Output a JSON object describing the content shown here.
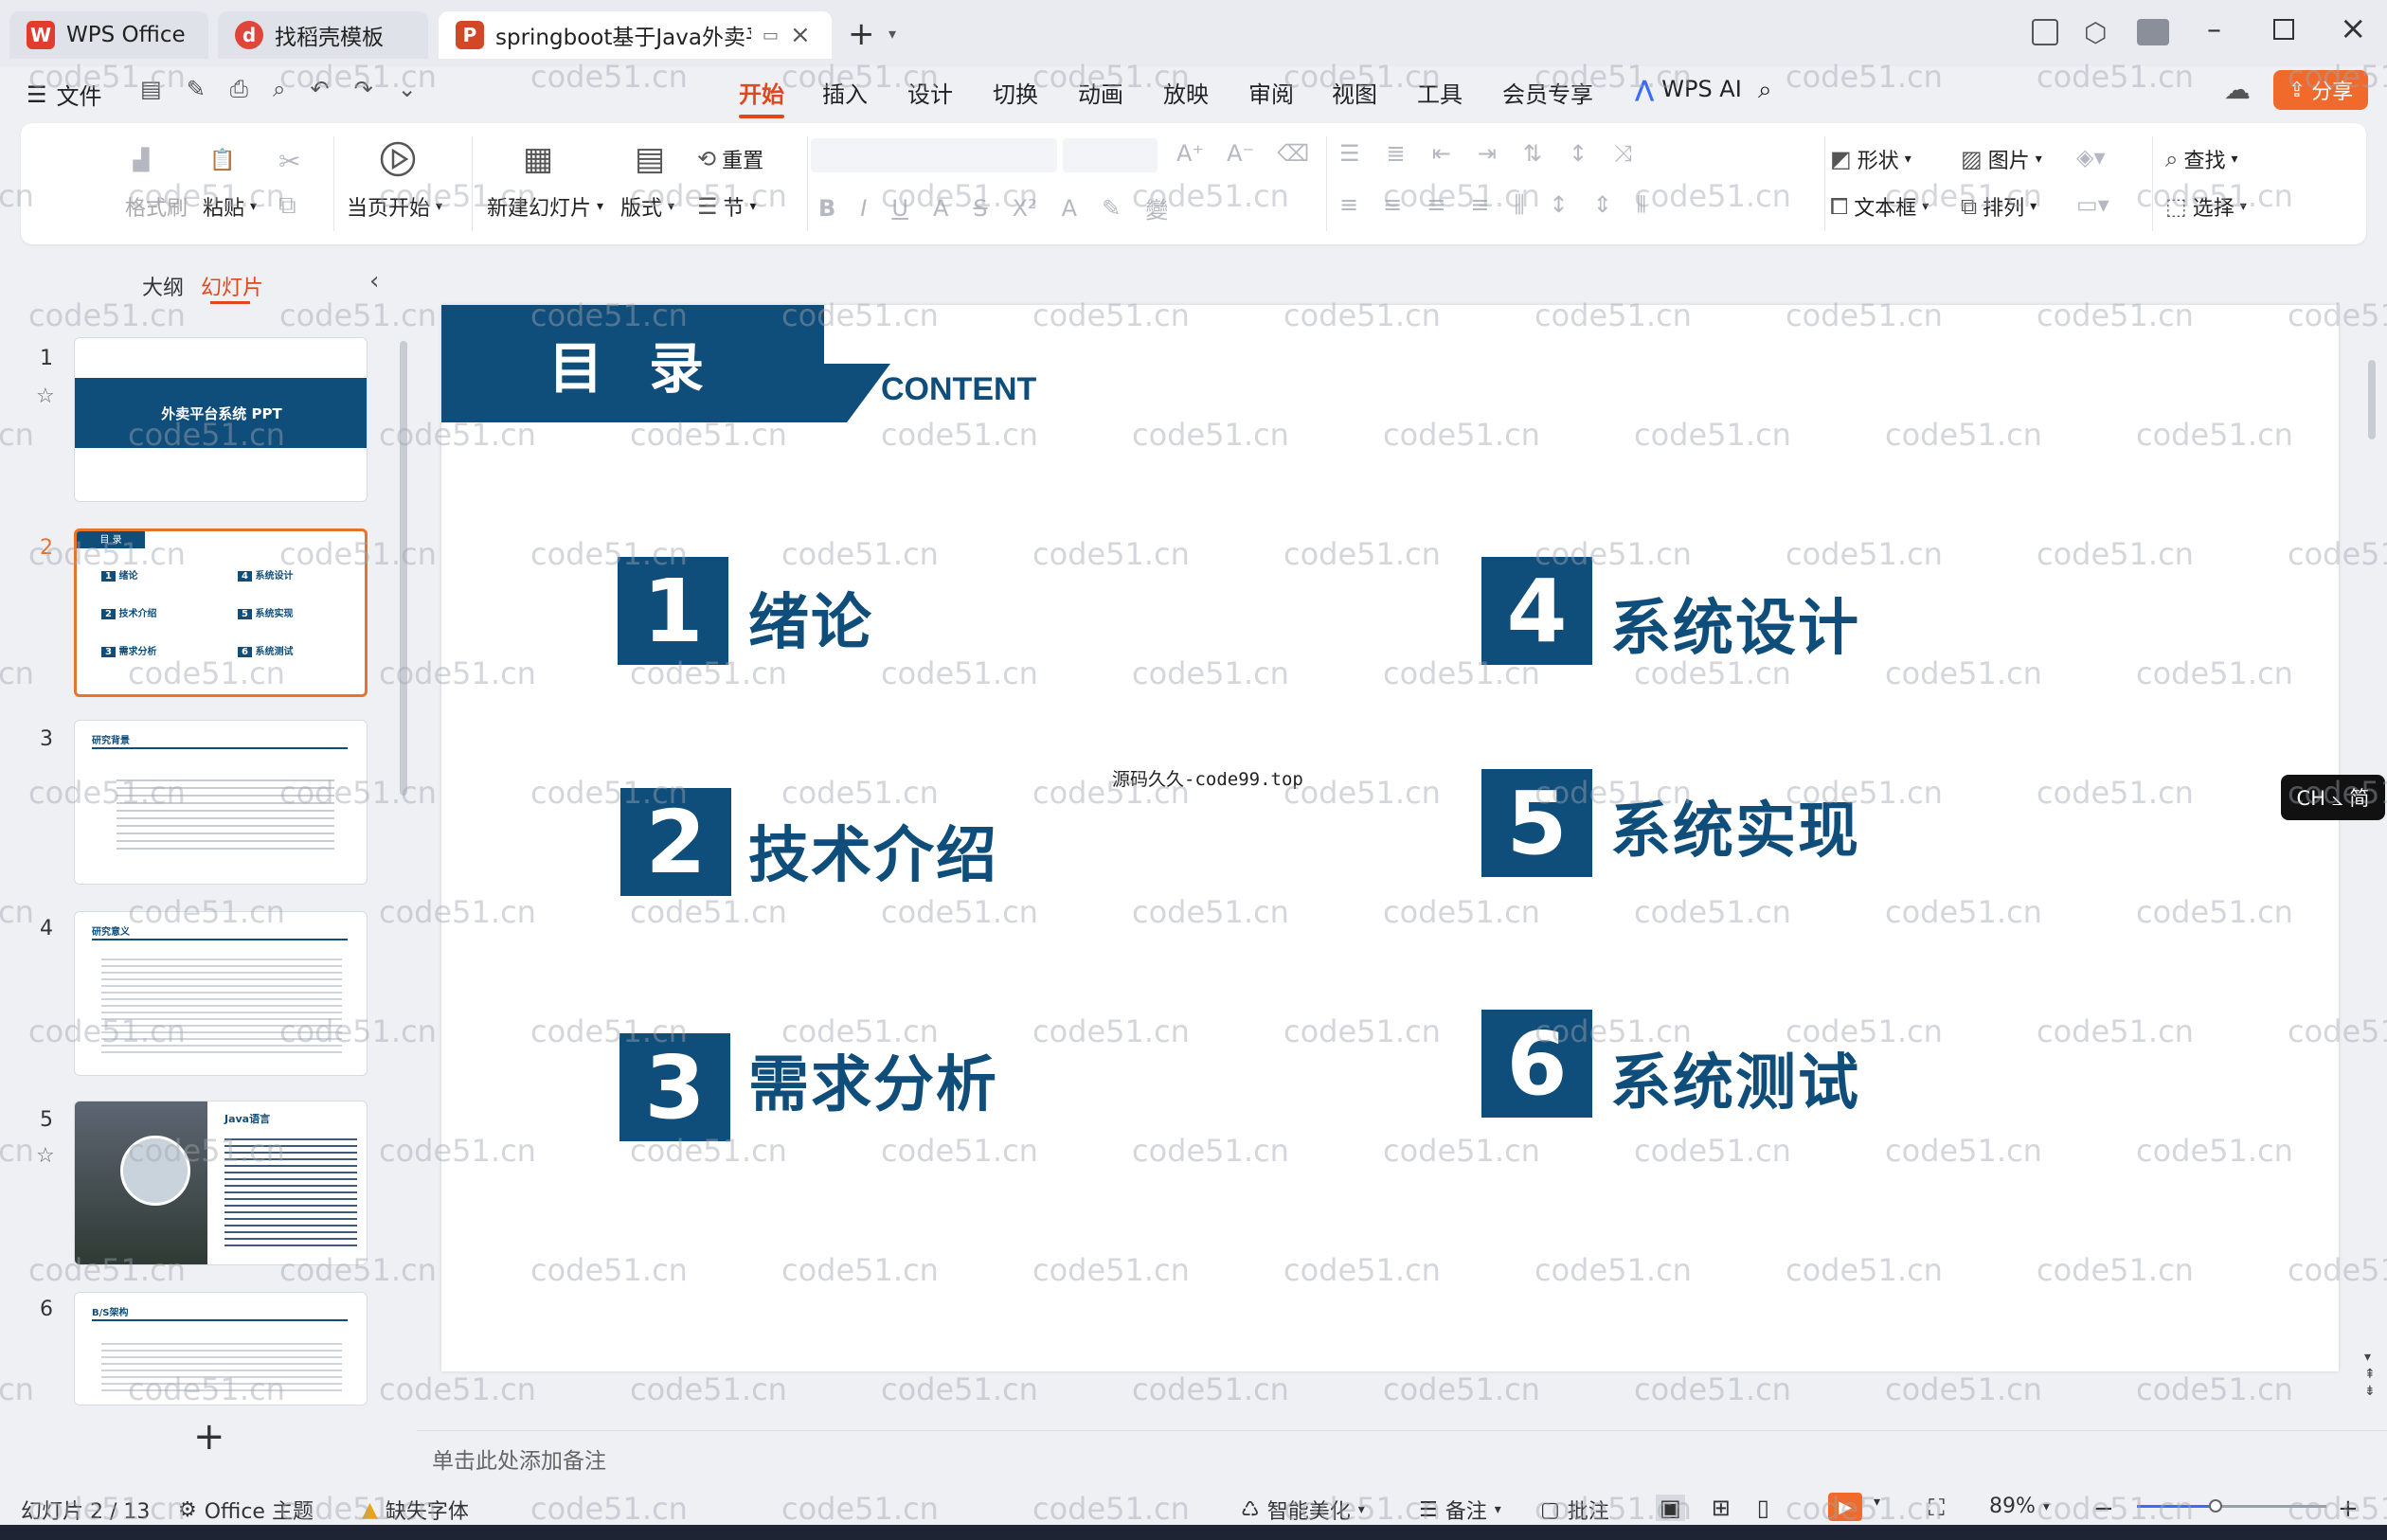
{
  "titlebar": {
    "tabs": [
      {
        "label": "WPS Office"
      },
      {
        "label": "找稻壳模板"
      },
      {
        "label": "springboot基于Java外卖平台"
      }
    ],
    "new_tab": "+",
    "window_controls": [
      "minimize",
      "maximize",
      "close"
    ]
  },
  "menu": {
    "file": "文件",
    "tabs": [
      "开始",
      "插入",
      "设计",
      "切换",
      "动画",
      "放映",
      "审阅",
      "视图",
      "工具",
      "会员专享"
    ],
    "active_tab": "开始",
    "wps_ai": "WPS AI",
    "share": "分享"
  },
  "ribbon": {
    "format_painter": "格式刷",
    "paste": "粘贴",
    "from_current": "当页开始",
    "new_slide": "新建幻灯片",
    "layout": "版式",
    "section": "节",
    "reset": "重置",
    "shape": "形状",
    "picture": "图片",
    "find": "查找",
    "textbox": "文本框",
    "arrange": "排列",
    "select": "选择"
  },
  "left_panel": {
    "tab_outline": "大纲",
    "tab_slides": "幻灯片",
    "active": "幻灯片",
    "thumb1_title": "外卖平台系统 PPT",
    "thumb2_title": "目 录",
    "thumb2_items": [
      "绪论",
      "技术介绍",
      "需求分析",
      "系统设计",
      "系统实现",
      "系统测试"
    ],
    "thumb3_title": "研究背景",
    "thumb4_title": "研究意义",
    "thumb5_title": "Java语言",
    "thumb6_title": "B/S架构",
    "slide_numbers": [
      "1",
      "2",
      "3",
      "4",
      "5",
      "6"
    ],
    "add": "+"
  },
  "slide": {
    "title": "目 录",
    "subtitle": "CONTENT",
    "items": [
      {
        "num": "1",
        "label": "绪论"
      },
      {
        "num": "2",
        "label": "技术介绍"
      },
      {
        "num": "3",
        "label": "需求分析"
      },
      {
        "num": "4",
        "label": "系统设计"
      },
      {
        "num": "5",
        "label": "系统实现"
      },
      {
        "num": "6",
        "label": "系统测试"
      }
    ],
    "center_text": "源码久久-code99.top"
  },
  "notes_placeholder": "单击此处添加备注",
  "ime": "CH ⦣ 简",
  "status": {
    "slide_count": "幻灯片 2 / 13",
    "theme": "Office 主题",
    "missing_font": "缺失字体",
    "beautify": "智能美化",
    "notes": "备注",
    "comments": "批注",
    "zoom": "89%"
  },
  "watermark_text": "code51.cn",
  "colors": {
    "accent": "#e0471c",
    "slide_blue": "#0f4d7a",
    "selection": "#e8742c",
    "share_btn": "#f06a2c"
  }
}
